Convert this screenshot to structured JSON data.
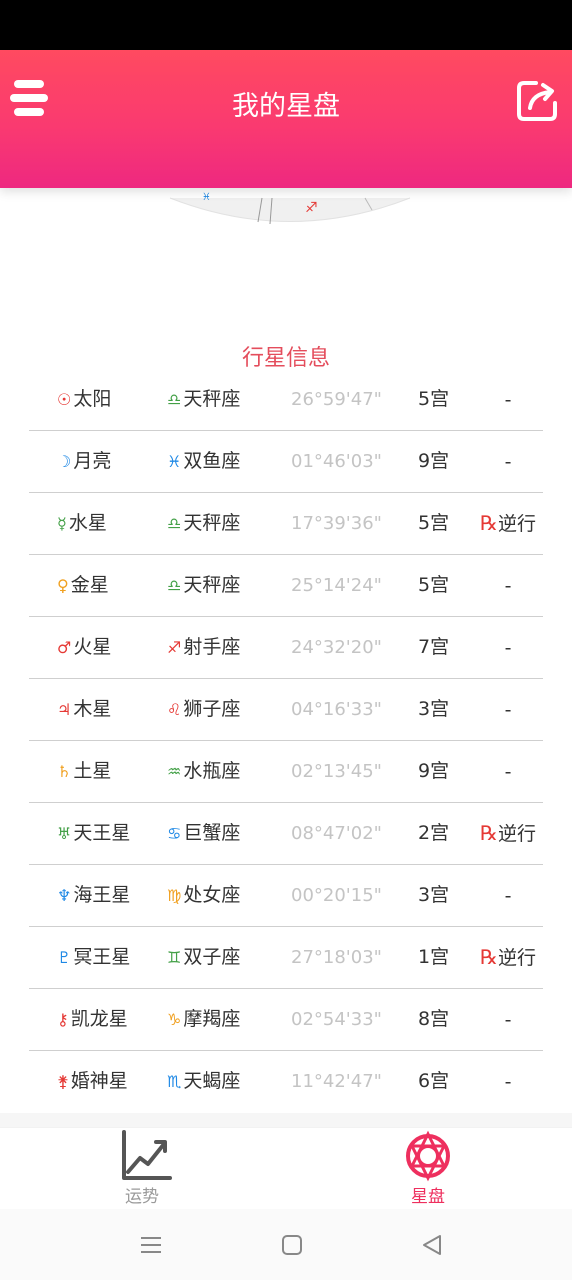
{
  "header": {
    "title": "我的星盘",
    "menu_icon": "hamburger-menu-icon",
    "share_icon": "share-icon"
  },
  "section_title": "行星信息",
  "colors": {
    "accent": "#ff4a60",
    "section_title": "#e44d5c",
    "tab_active": "#ee2f5e",
    "tab_inactive": "#9a9a9a",
    "fire": "#e53935",
    "water": "#1e88e5",
    "air": "#43a047",
    "earth": "#f0a020"
  },
  "planets": [
    {
      "symbol": "☉",
      "symbol_color": "#e53935",
      "name": "太阳",
      "sign_symbol": "♎",
      "sign_color": "#43a047",
      "sign": "天秤座",
      "degree": "26°59'47\"",
      "house": "5宫",
      "status": "-",
      "rx": ""
    },
    {
      "symbol": "☽",
      "symbol_color": "#1e88e5",
      "name": "月亮",
      "sign_symbol": "♓",
      "sign_color": "#1e88e5",
      "sign": "双鱼座",
      "degree": "01°46'03\"",
      "house": "9宫",
      "status": "-",
      "rx": ""
    },
    {
      "symbol": "☿",
      "symbol_color": "#43a047",
      "name": "水星",
      "sign_symbol": "♎",
      "sign_color": "#43a047",
      "sign": "天秤座",
      "degree": "17°39'36\"",
      "house": "5宫",
      "status": "逆行",
      "rx": "℞"
    },
    {
      "symbol": "♀",
      "symbol_color": "#f0a020",
      "name": "金星",
      "sign_symbol": "♎",
      "sign_color": "#43a047",
      "sign": "天秤座",
      "degree": "25°14'24\"",
      "house": "5宫",
      "status": "-",
      "rx": ""
    },
    {
      "symbol": "♂",
      "symbol_color": "#e53935",
      "name": "火星",
      "sign_symbol": "♐",
      "sign_color": "#e53935",
      "sign": "射手座",
      "degree": "24°32'20\"",
      "house": "7宫",
      "status": "-",
      "rx": ""
    },
    {
      "symbol": "♃",
      "symbol_color": "#e53935",
      "name": "木星",
      "sign_symbol": "♌",
      "sign_color": "#e53935",
      "sign": "狮子座",
      "degree": "04°16'33\"",
      "house": "3宫",
      "status": "-",
      "rx": ""
    },
    {
      "symbol": "♄",
      "symbol_color": "#f0a020",
      "name": "土星",
      "sign_symbol": "♒",
      "sign_color": "#43a047",
      "sign": "水瓶座",
      "degree": "02°13'45\"",
      "house": "9宫",
      "status": "-",
      "rx": ""
    },
    {
      "symbol": "♅",
      "symbol_color": "#43a047",
      "name": "天王星",
      "sign_symbol": "♋",
      "sign_color": "#1e88e5",
      "sign": "巨蟹座",
      "degree": "08°47'02\"",
      "house": "2宫",
      "status": "逆行",
      "rx": "℞"
    },
    {
      "symbol": "♆",
      "symbol_color": "#1e88e5",
      "name": "海王星",
      "sign_symbol": "♍",
      "sign_color": "#f0a020",
      "sign": "处女座",
      "degree": "00°20'15\"",
      "house": "3宫",
      "status": "-",
      "rx": ""
    },
    {
      "symbol": "♇",
      "symbol_color": "#1e88e5",
      "name": "冥王星",
      "sign_symbol": "♊",
      "sign_color": "#43a047",
      "sign": "双子座",
      "degree": "27°18'03\"",
      "house": "1宫",
      "status": "逆行",
      "rx": "℞"
    },
    {
      "symbol": "⚷",
      "symbol_color": "#e53935",
      "name": "凯龙星",
      "sign_symbol": "♑",
      "sign_color": "#f0a020",
      "sign": "摩羯座",
      "degree": "02°54'33\"",
      "house": "8宫",
      "status": "-",
      "rx": ""
    },
    {
      "symbol": "⚵",
      "symbol_color": "#e53935",
      "name": "婚神星",
      "sign_symbol": "♏",
      "sign_color": "#1e88e5",
      "sign": "天蝎座",
      "degree": "11°42'47\"",
      "house": "6宫",
      "status": "-",
      "rx": ""
    }
  ],
  "tabs": [
    {
      "label": "运势",
      "icon": "trend-chart-icon",
      "active": false
    },
    {
      "label": "星盘",
      "icon": "astro-wheel-icon",
      "active": true
    }
  ],
  "navbar": {
    "menu_icon": "recent-apps-icon",
    "home_icon": "home-icon",
    "back_icon": "back-icon"
  }
}
